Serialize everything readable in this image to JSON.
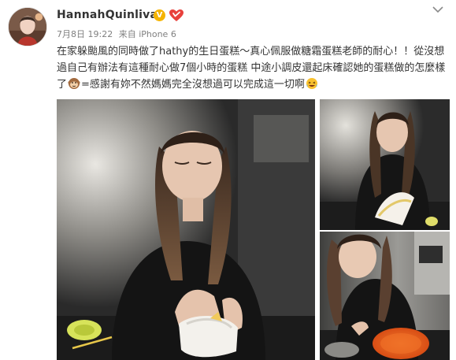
{
  "post": {
    "author": "HannahQuinlivan",
    "verified_badge": "V",
    "timestamp": "7月8日 19:22",
    "source": "来自 iPhone 6",
    "text_part1": "在家躲颱風的同時做了hathy的生日蛋糕～真心佩服做糖霜蛋糕老師的耐心！！從沒想過自己有辦法有這種耐心做7個小時的蛋糕 中途小調皮還起床確認她的蛋糕做的怎麼樣了",
    "text_part2": "=感謝有妳不然媽媽完全沒想過可以完成這一切啊",
    "icons": {
      "avatar": "avatar-photo",
      "verified": "verified-v-badge",
      "vip": "vip-heart-icon",
      "menu": "chevron-down-icon",
      "emoji_1": "monkey-face-emoji",
      "emoji_2": "laughing-tears-emoji"
    },
    "colors": {
      "author": "#333333",
      "meta": "#808080",
      "badge": "#f5b400",
      "vip": "#e8413c"
    },
    "photos": [
      {
        "caption": "",
        "content": "woman-icing-cake-main"
      },
      {
        "caption": "",
        "content": "woman-holding-decorated-cake"
      },
      {
        "caption": "",
        "content": "woman-decorating-orange-cake"
      }
    ]
  }
}
